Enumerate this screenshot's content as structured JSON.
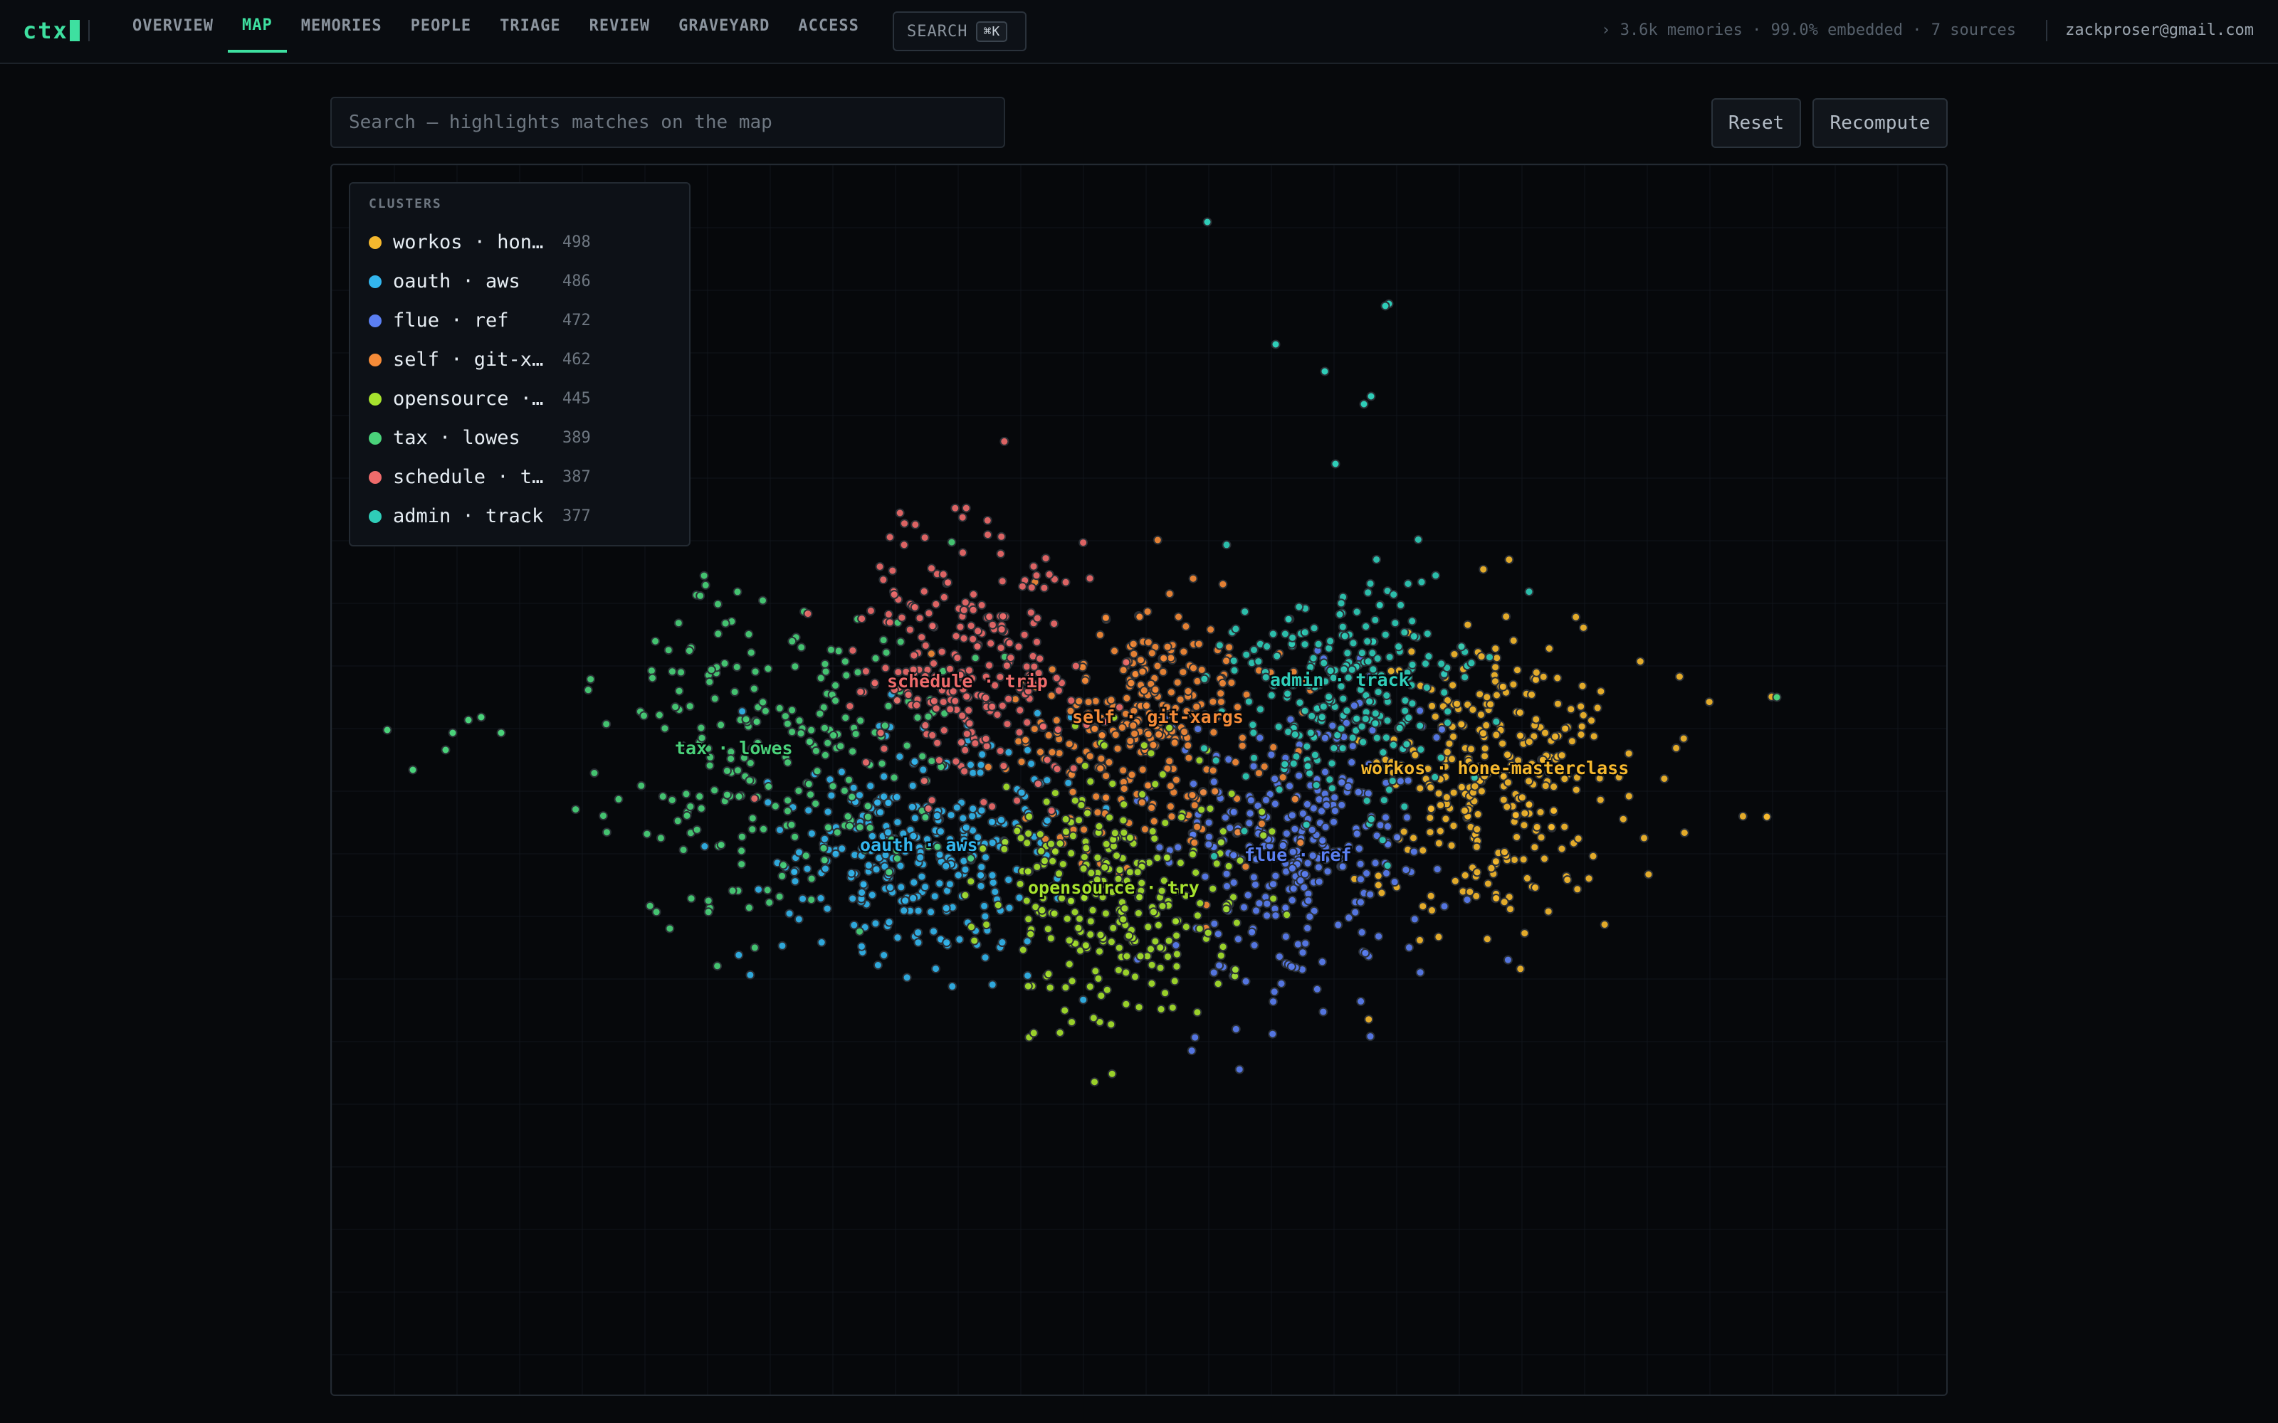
{
  "app": {
    "logo": "ctx"
  },
  "nav": {
    "items": [
      {
        "label": "OVERVIEW",
        "active": false
      },
      {
        "label": "MAP",
        "active": true
      },
      {
        "label": "MEMORIES",
        "active": false
      },
      {
        "label": "PEOPLE",
        "active": false
      },
      {
        "label": "TRIAGE",
        "active": false
      },
      {
        "label": "REVIEW",
        "active": false
      },
      {
        "label": "GRAVEYARD",
        "active": false
      },
      {
        "label": "ACCESS",
        "active": false
      }
    ],
    "search_label": "SEARCH",
    "search_shortcut": "⌘K"
  },
  "status": {
    "text": "› 3.6k memories · 99.0% embedded · 7 sources"
  },
  "user": {
    "email": "zackproser@gmail.com"
  },
  "toolbar": {
    "search_placeholder": "Search — highlights matches on the map",
    "search_value": "",
    "reset_label": "Reset",
    "recompute_label": "Recompute"
  },
  "legend": {
    "title": "CLUSTERS",
    "items": [
      {
        "label": "workos · hone-masterclass",
        "count": "498",
        "color": "#f5b82e"
      },
      {
        "label": "oauth · aws",
        "count": "486",
        "color": "#33b6ee"
      },
      {
        "label": "flue · ref",
        "count": "472",
        "color": "#5b7ff2"
      },
      {
        "label": "self · git-xargs",
        "count": "462",
        "color": "#f58b38"
      },
      {
        "label": "opensource · try",
        "count": "445",
        "color": "#a6e22e"
      },
      {
        "label": "tax · lowes",
        "count": "389",
        "color": "#4ad27a"
      },
      {
        "label": "schedule · trip",
        "count": "387",
        "color": "#ee6b6b"
      },
      {
        "label": "admin · track",
        "count": "377",
        "color": "#2fcdb8"
      }
    ]
  },
  "map_labels": [
    "schedule · trip",
    "admin · track",
    "self · git-xargs",
    "tax · lowes",
    "workos · hone-masterclass",
    "oauth · aws",
    "flue · ref",
    "opensource · try"
  ]
}
